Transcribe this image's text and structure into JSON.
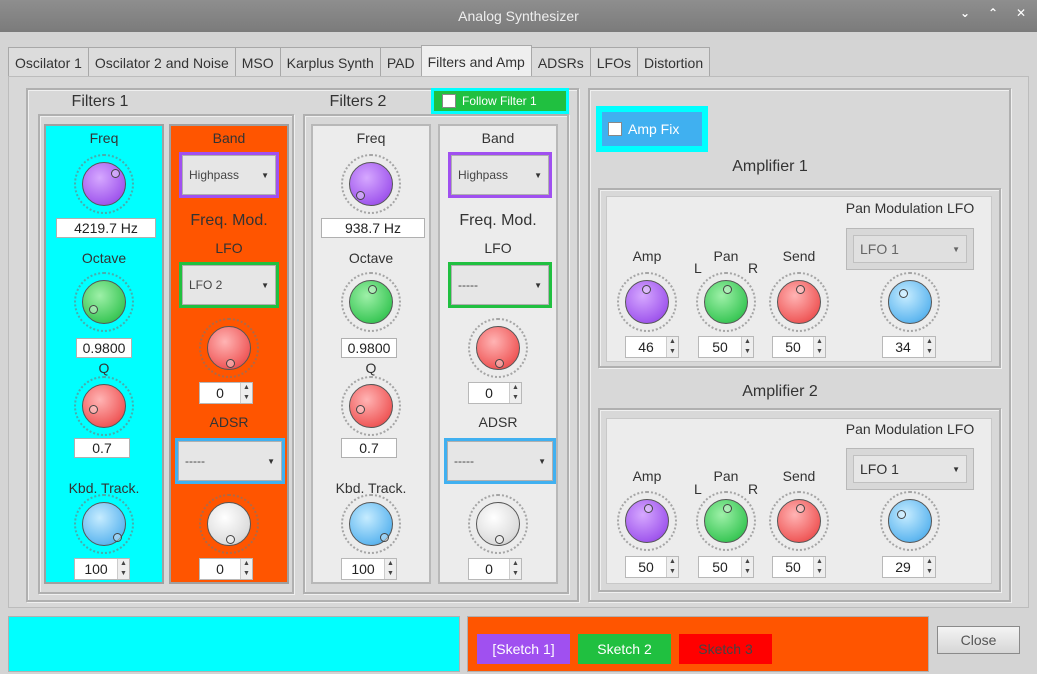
{
  "window": {
    "title": "Analog Synthesizer"
  },
  "tabs": [
    {
      "label": "Oscilator 1"
    },
    {
      "label": "Oscilator 2 and Noise"
    },
    {
      "label": "MSO"
    },
    {
      "label": "Karplus Synth"
    },
    {
      "label": "PAD"
    },
    {
      "label": "Filters and Amp",
      "active": true
    },
    {
      "label": "ADSRs"
    },
    {
      "label": "LFOs"
    },
    {
      "label": "Distortion"
    }
  ],
  "filters1": {
    "title": "Filters 1",
    "freq": {
      "label": "Freq",
      "value": "4219.7 Hz"
    },
    "octave": {
      "label": "Octave",
      "value": "0.9800"
    },
    "q": {
      "label": "Q",
      "value": "0.7"
    },
    "kbd": {
      "label": "Kbd. Track.",
      "value": "100"
    },
    "band": {
      "label": "Band",
      "value": "Highpass"
    },
    "freqmod": {
      "label": "Freq. Mod."
    },
    "lfo": {
      "label": "LFO",
      "value": "LFO 2",
      "amount": "0"
    },
    "adsr": {
      "label": "ADSR",
      "value": "-----",
      "amount": "0"
    }
  },
  "filters2": {
    "title": "Filters 2",
    "follow": "Follow Filter 1",
    "freq": {
      "label": "Freq",
      "value": "938.7 Hz"
    },
    "octave": {
      "label": "Octave",
      "value": "0.9800"
    },
    "q": {
      "label": "Q",
      "value": "0.7"
    },
    "kbd": {
      "label": "Kbd. Track.",
      "value": "100"
    },
    "band": {
      "label": "Band",
      "value": "Highpass"
    },
    "freqmod": {
      "label": "Freq. Mod."
    },
    "lfo": {
      "label": "LFO",
      "value": "-----",
      "amount": "0"
    },
    "adsr": {
      "label": "ADSR",
      "value": "-----",
      "amount": "0"
    }
  },
  "ampfix": {
    "label": "Amp Fix"
  },
  "amp1": {
    "title": "Amplifier 1",
    "amp": {
      "label": "Amp",
      "value": "46"
    },
    "pan": {
      "label": "Pan",
      "left": "L",
      "right": "R",
      "value": "50"
    },
    "send": {
      "label": "Send",
      "value": "50"
    },
    "panlfo": {
      "label": "Pan Modulation LFO",
      "value": "LFO 1",
      "amount": "34"
    }
  },
  "amp2": {
    "title": "Amplifier 2",
    "amp": {
      "label": "Amp",
      "value": "50"
    },
    "pan": {
      "label": "Pan",
      "left": "L",
      "right": "R",
      "value": "50"
    },
    "send": {
      "label": "Send",
      "value": "50"
    },
    "panlfo": {
      "label": "Pan Modulation LFO",
      "value": "LFO 1",
      "amount": "29"
    }
  },
  "sketches": [
    {
      "label": "[Sketch 1]"
    },
    {
      "label": "Sketch 2"
    },
    {
      "label": "Sketch 3"
    }
  ],
  "close": "Close",
  "colors": {
    "cyan": "#00ffff",
    "orange": "#ff5500",
    "purple": "#a050f0",
    "green": "#20c040",
    "red": "#ff0000",
    "blue": "#40b0f0"
  }
}
